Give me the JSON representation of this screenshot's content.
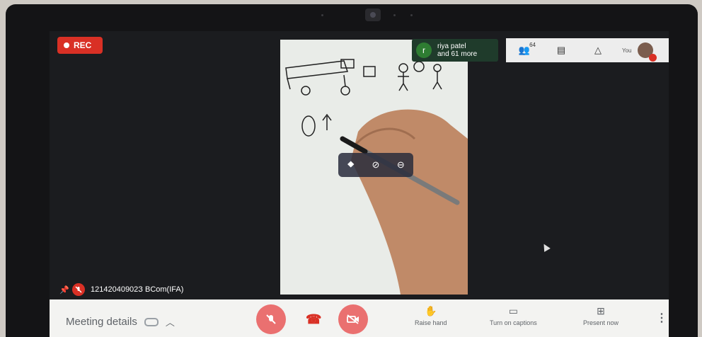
{
  "recording": {
    "label": "REC"
  },
  "presenter": {
    "initial": "r",
    "line1": "riya patel",
    "line2": "and 61 more"
  },
  "topbar": {
    "participants_count": "64",
    "self_label": "You"
  },
  "participant_label": {
    "name": "12142040902З BCom(IFA)"
  },
  "bottombar": {
    "meeting_details_label": "Meeting details",
    "raise_hand_label": "Raise hand",
    "captions_label": "Turn on captions",
    "present_label": "Present now"
  },
  "icons": {
    "rec": "record-dot-icon",
    "participants": "people-icon",
    "chat": "chat-icon",
    "activities": "activities-icon",
    "pin": "pin-icon",
    "mic_off": "mic-off-icon",
    "camera_off": "camera-off-icon",
    "hangup": "hangup-icon",
    "raise_hand": "hand-icon",
    "captions": "captions-icon",
    "present": "present-icon",
    "more": "more-vert-icon"
  },
  "colors": {
    "record": "#d93025",
    "control_bar": "#f3f3f1",
    "screen": "#1b1c1f"
  }
}
